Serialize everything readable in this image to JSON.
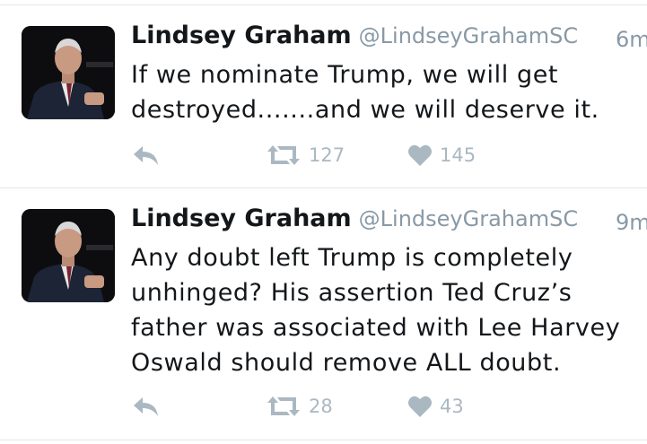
{
  "tweets": [
    {
      "name": "Lindsey Graham",
      "handle": "@LindseyGrahamSC",
      "time": "6m",
      "text": "If we nominate Trump, we will get destroyed.......and we will deserve it.",
      "retweets": "127",
      "likes": "145"
    },
    {
      "name": "Lindsey Graham",
      "handle": "@LindseyGrahamSC",
      "time": "9m",
      "text": "Any doubt left Trump is completely unhinged? His assertion Ted Cruz’s father was associated with Lee Harvey Oswald should remove ALL doubt.",
      "retweets": "28",
      "likes": "43"
    }
  ],
  "colors": {
    "name": "#14171a",
    "meta": "#8899a6",
    "action": "#aab8c2",
    "divider": "#e1e8ed"
  },
  "icons": {
    "reply": "reply-icon",
    "retweet": "retweet-icon",
    "like": "heart-icon"
  }
}
